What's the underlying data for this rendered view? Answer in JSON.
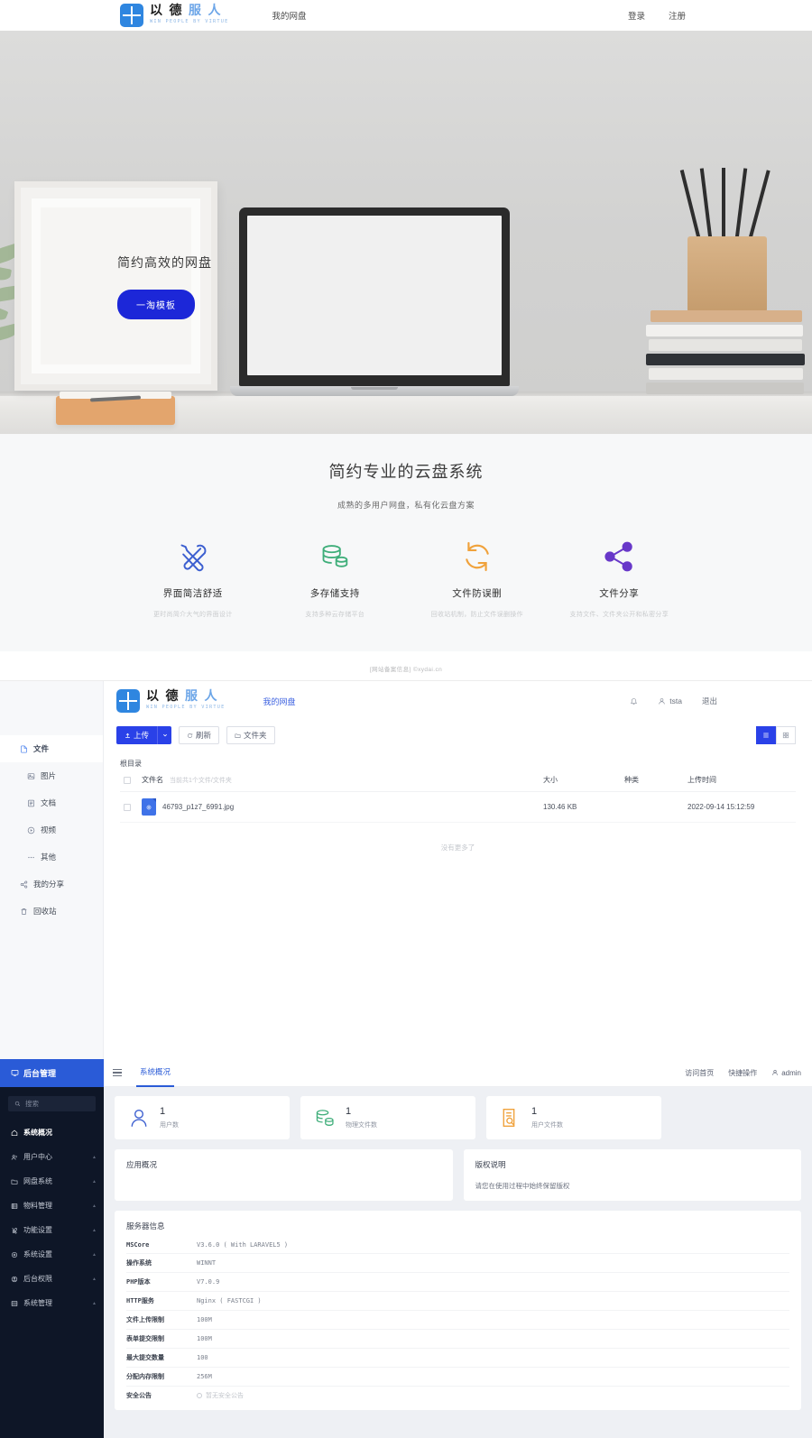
{
  "brand": {
    "cn_dark": "以 德",
    "cn_light": "服 人",
    "en": "WIN PEOPLE BY VIRTUE"
  },
  "site_header": {
    "nav": [
      {
        "label": "我的网盘"
      }
    ],
    "login": "登录",
    "register": "注册"
  },
  "hero": {
    "title": "简约高效的网盘",
    "button": "一淘模板"
  },
  "features": {
    "title": "简约专业的云盘系统",
    "subtitle": "成熟的多用户网盘，私有化云盘方案",
    "items": [
      {
        "name": "界面简洁舒适",
        "desc": "更时尚简介大气的界面设计",
        "icon": "tools-icon",
        "color": "#3c5fd0"
      },
      {
        "name": "多存储支持",
        "desc": "支持多种云存储平台",
        "icon": "database-icon",
        "color": "#3fae7a"
      },
      {
        "name": "文件防误删",
        "desc": "回收站机制，防止文件误删操作",
        "icon": "refresh-icon",
        "color": "#f0a23c"
      },
      {
        "name": "文件分享",
        "desc": "支持文件、文件夹公开和私密分享",
        "icon": "share-icon",
        "color": "#6838c9"
      }
    ]
  },
  "site_footer": {
    "text": "[网站备案信息] ©xydai.cn"
  },
  "disk": {
    "nav": [
      {
        "label": "我的网盘"
      }
    ],
    "header_right": {
      "bell": "bell-icon",
      "user": "tsta",
      "logout": "退出"
    },
    "sidebar": [
      {
        "label": "文件",
        "icon": "file-icon",
        "active": true,
        "sub": false
      },
      {
        "label": "图片",
        "icon": "image-icon",
        "active": false,
        "sub": true
      },
      {
        "label": "文档",
        "icon": "doc-icon",
        "active": false,
        "sub": true
      },
      {
        "label": "视频",
        "icon": "video-icon",
        "active": false,
        "sub": true
      },
      {
        "label": "其他",
        "icon": "ellipsis-icon",
        "active": false,
        "sub": true
      },
      {
        "label": "我的分享",
        "icon": "share-icon",
        "active": false,
        "sub": false
      },
      {
        "label": "回收站",
        "icon": "trash-icon",
        "active": false,
        "sub": false
      }
    ],
    "toolbar": {
      "upload": "上传",
      "refresh": "刷新",
      "folder": "文件夹",
      "view_list": "list-view-icon",
      "view_grid": "grid-view-icon"
    },
    "breadcrumb": "根目录",
    "table": {
      "headers": {
        "name": "文件名",
        "count_hint": "当前共1个文件/文件夹",
        "size": "大小",
        "kind": "种类",
        "time": "上传时间"
      },
      "rows": [
        {
          "name": "46793_p1z7_6991.jpg",
          "size": "130.46 KB",
          "kind": "",
          "time": "2022-09-14 15:12:59"
        }
      ],
      "no_more": "没有更多了"
    }
  },
  "admin": {
    "logo": "后台管理",
    "search_placeholder": "搜索",
    "menu": [
      {
        "label": "系统概况",
        "icon": "home-icon",
        "active": true,
        "caret": false
      },
      {
        "label": "用户中心",
        "icon": "users-icon",
        "active": false,
        "caret": true
      },
      {
        "label": "网盘系统",
        "icon": "folder-icon",
        "active": false,
        "caret": true
      },
      {
        "label": "物料管理",
        "icon": "list-icon",
        "active": false,
        "caret": true
      },
      {
        "label": "功能设置",
        "icon": "tools-icon",
        "active": false,
        "caret": true
      },
      {
        "label": "系统设置",
        "icon": "gear-icon",
        "active": false,
        "caret": true
      },
      {
        "label": "后台权限",
        "icon": "shield-icon",
        "active": false,
        "caret": true
      },
      {
        "label": "系统管理",
        "icon": "server-icon",
        "active": false,
        "caret": true
      }
    ],
    "tab": "系统概况",
    "top_right": {
      "home": "访问首页",
      "quick": "快捷操作",
      "user": "admin"
    },
    "stats": [
      {
        "value": "1",
        "label": "用户数",
        "icon": "user-icon",
        "color": "#3c5fd0"
      },
      {
        "value": "1",
        "label": "物理文件数",
        "icon": "database-icon",
        "color": "#3fae7a"
      },
      {
        "value": "1",
        "label": "用户文件数",
        "icon": "doc-search-icon",
        "color": "#f0a23c"
      }
    ],
    "panels": [
      {
        "title": "应用概况",
        "text": ""
      },
      {
        "title": "版权说明",
        "text": "请您在使用过程中始终保留版权"
      }
    ],
    "server": {
      "title": "服务器信息",
      "rows": [
        {
          "key": "MSCore",
          "value": "V3.6.0 ( With LARAVEL5 )",
          "muted": false
        },
        {
          "key": "操作系统",
          "value": "WINNT",
          "muted": false
        },
        {
          "key": "PHP版本",
          "value": "V7.0.9",
          "muted": false
        },
        {
          "key": "HTTP服务",
          "value": "Nginx ( FASTCGI )",
          "muted": false
        },
        {
          "key": "文件上传限制",
          "value": "100M",
          "muted": false
        },
        {
          "key": "表单提交限制",
          "value": "100M",
          "muted": false
        },
        {
          "key": "最大提交数量",
          "value": "100",
          "muted": false
        },
        {
          "key": "分配内存限制",
          "value": "256M",
          "muted": false
        },
        {
          "key": "安全公告",
          "value": "暂无安全公告",
          "muted": true
        }
      ]
    }
  }
}
